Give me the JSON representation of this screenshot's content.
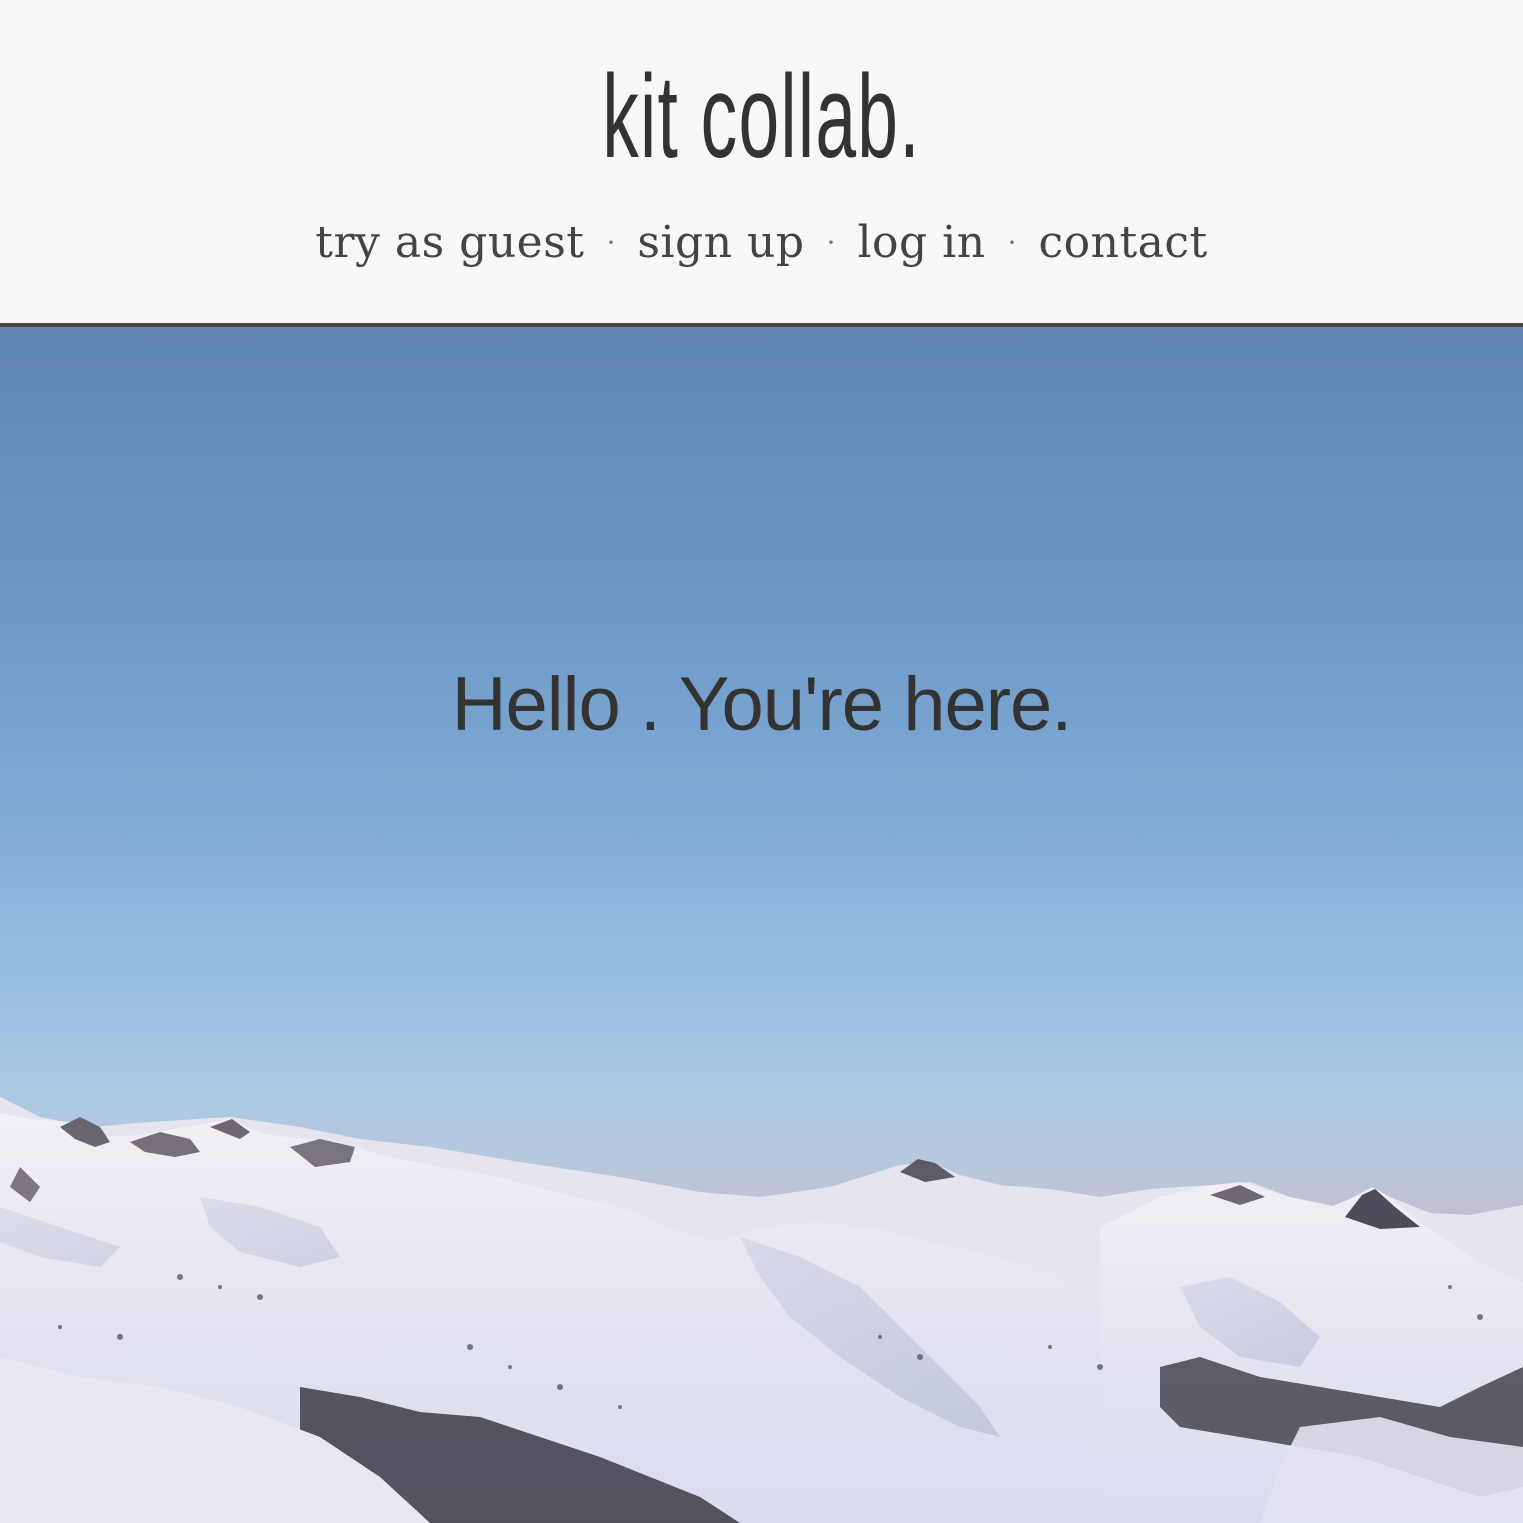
{
  "header": {
    "brand": "kit collab.",
    "nav": [
      {
        "label": "try as guest"
      },
      {
        "label": "sign up"
      },
      {
        "label": "log in"
      },
      {
        "label": "contact"
      }
    ],
    "separator": "·"
  },
  "hero": {
    "tagline": "Hello . You're here.",
    "background": "mountain-landscape-photo"
  },
  "colors": {
    "header_bg": "#f8f8f8",
    "text": "#333333",
    "divider": "#4a4a4a",
    "sky_top": "#5f86b4",
    "sky_bottom": "#abc9e4",
    "snow": "#eef0f6"
  }
}
